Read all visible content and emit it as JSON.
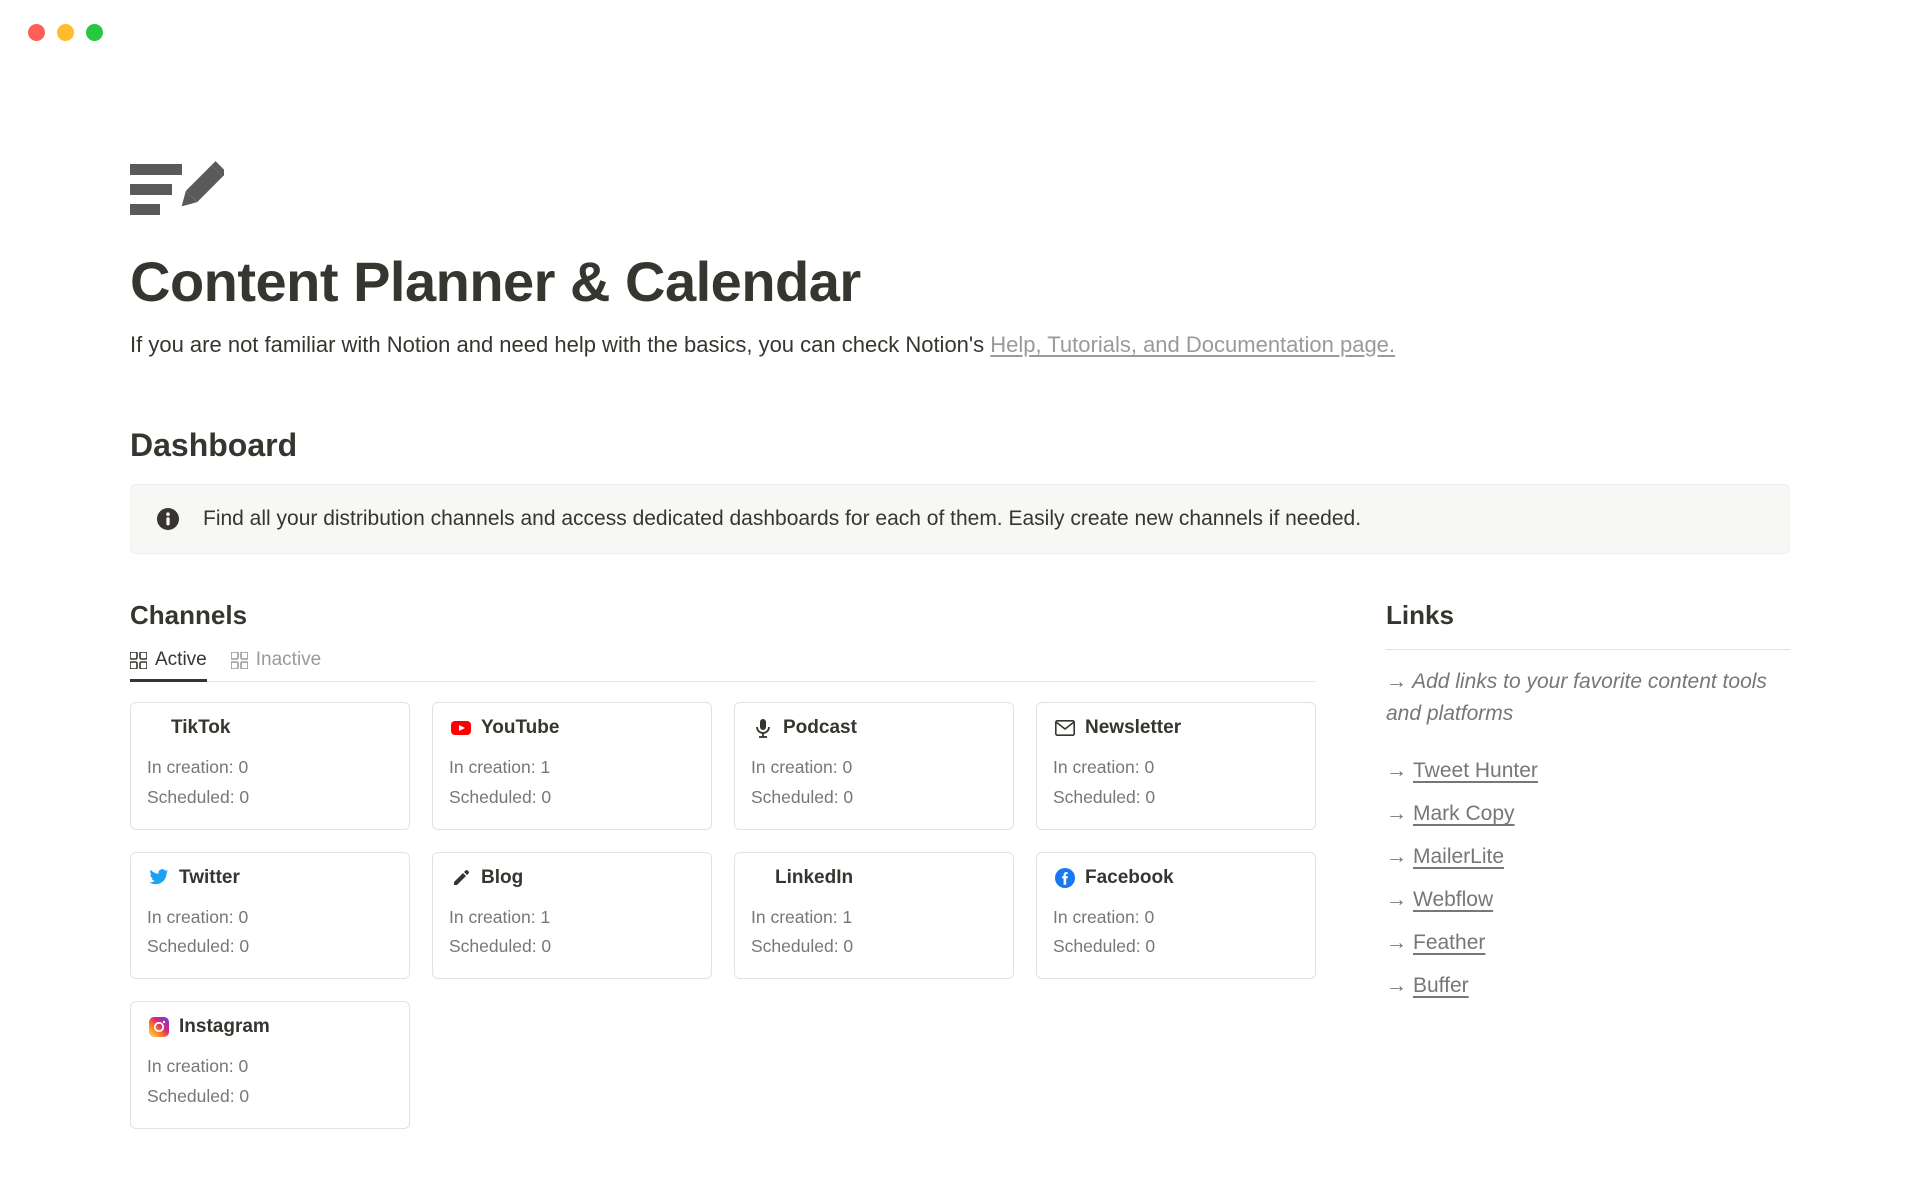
{
  "header": {
    "title": "Content Planner & Calendar",
    "subtitle_prefix": "If you are not familiar with Notion and need help with the basics, you can check Notion's ",
    "subtitle_link": "Help, Tutorials, and Documentation page."
  },
  "dashboard": {
    "heading": "Dashboard",
    "callout": "Find all your distribution channels and access dedicated dashboards for each of them. Easily create new channels if needed."
  },
  "channels": {
    "heading": "Channels",
    "tabs": {
      "active": "Active",
      "inactive": "Inactive"
    },
    "label_creation": "In creation: ",
    "label_scheduled": "Scheduled: ",
    "items": [
      {
        "name": "TikTok",
        "icon": "none",
        "in_creation": 0,
        "scheduled": 0
      },
      {
        "name": "YouTube",
        "icon": "youtube",
        "in_creation": 1,
        "scheduled": 0
      },
      {
        "name": "Podcast",
        "icon": "mic",
        "in_creation": 0,
        "scheduled": 0
      },
      {
        "name": "Newsletter",
        "icon": "mail",
        "in_creation": 0,
        "scheduled": 0
      },
      {
        "name": "Twitter",
        "icon": "twitter",
        "in_creation": 0,
        "scheduled": 0
      },
      {
        "name": "Blog",
        "icon": "pencil",
        "in_creation": 1,
        "scheduled": 0
      },
      {
        "name": "LinkedIn",
        "icon": "none",
        "in_creation": 1,
        "scheduled": 0
      },
      {
        "name": "Facebook",
        "icon": "facebook",
        "in_creation": 0,
        "scheduled": 0
      },
      {
        "name": "Instagram",
        "icon": "instagram",
        "in_creation": 0,
        "scheduled": 0
      }
    ]
  },
  "links": {
    "heading": "Links",
    "hint_prefix": "→ ",
    "hint": "Add links to your favorite content tools and platforms",
    "items": [
      "Tweet Hunter",
      "Mark Copy",
      "MailerLite",
      "Webflow",
      "Feather",
      "Buffer"
    ]
  }
}
